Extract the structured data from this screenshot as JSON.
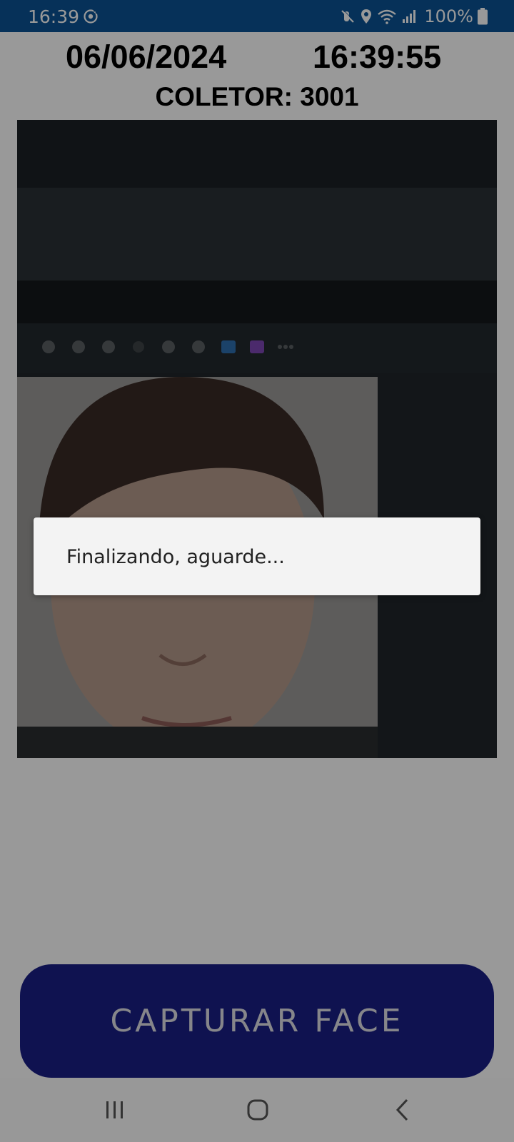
{
  "status_bar": {
    "time": "16:39",
    "battery_text": "100%",
    "icons": [
      "sync-icon",
      "mute-icon",
      "location-icon",
      "wifi-icon",
      "signal-icon",
      "battery-icon"
    ],
    "background_color": "#0b5394"
  },
  "header": {
    "date": "06/06/2024",
    "clock": "16:39:55",
    "collector": "COLETOR: 3001"
  },
  "camera": {
    "content": "live camera preview showing a face"
  },
  "dialog": {
    "message": "Finalizando, aguarde..."
  },
  "actions": {
    "capture_label": "CAPTURAR FACE",
    "button_color": "#1a1f86"
  },
  "nav_bar": {
    "icons": [
      "recent-apps-icon",
      "home-icon",
      "back-icon"
    ]
  }
}
